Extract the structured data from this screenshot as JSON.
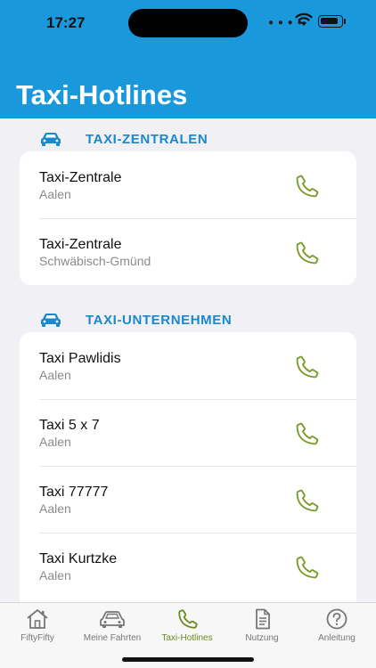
{
  "status": {
    "time": "17:27"
  },
  "page": {
    "title": "Taxi-Hotlines"
  },
  "sections": [
    {
      "title": "TAXI-ZENTRALEN",
      "icon": "car-icon",
      "items": [
        {
          "name": "Taxi-Zentrale",
          "city": "Aalen"
        },
        {
          "name": "Taxi-Zentrale",
          "city": "Schwäbisch-Gmünd"
        }
      ]
    },
    {
      "title": "TAXI-UNTERNEHMEN",
      "icon": "car-icon",
      "items": [
        {
          "name": "Taxi Pawlidis",
          "city": "Aalen"
        },
        {
          "name": "Taxi 5 x 7",
          "city": "Aalen"
        },
        {
          "name": "Taxi 77777",
          "city": "Aalen"
        },
        {
          "name": "Taxi Kurtzke",
          "city": "Aalen"
        }
      ]
    }
  ],
  "tabbar": {
    "tabs": [
      {
        "label": "FiftyFifty",
        "icon": "house-icon",
        "active": false
      },
      {
        "label": "Meine Fahrten",
        "icon": "car-icon",
        "active": false
      },
      {
        "label": "Taxi-Hotlines",
        "icon": "phone-icon",
        "active": true
      },
      {
        "label": "Nutzung",
        "icon": "document-icon",
        "active": false
      },
      {
        "label": "Anleitung",
        "icon": "question-icon",
        "active": false
      }
    ]
  },
  "colors": {
    "header": "#1a98dc",
    "accent": "#1a88cc",
    "phone": "#7a9a2a",
    "active_tab": "#6b8a1e"
  }
}
